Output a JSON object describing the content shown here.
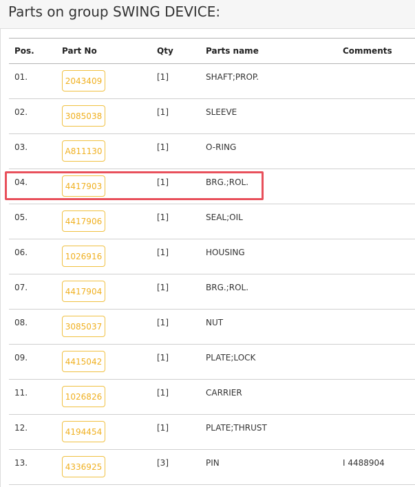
{
  "page": {
    "title": "Parts on group SWING DEVICE:"
  },
  "table": {
    "headers": {
      "pos": "Pos.",
      "part_no": "Part No",
      "qty": "Qty",
      "parts_name": "Parts name",
      "comments": "Comments"
    },
    "rows": [
      {
        "pos": "01.",
        "part_no": "2043409",
        "qty": "[1]",
        "name": "SHAFT;PROP.",
        "comments": ""
      },
      {
        "pos": "02.",
        "part_no": "3085038",
        "qty": "[1]",
        "name": "SLEEVE",
        "comments": ""
      },
      {
        "pos": "03.",
        "part_no": "A811130",
        "qty": "[1]",
        "name": "O-RING",
        "comments": ""
      },
      {
        "pos": "04.",
        "part_no": "4417903",
        "qty": "[1]",
        "name": "BRG.;ROL.",
        "comments": "",
        "highlighted": true
      },
      {
        "pos": "05.",
        "part_no": "4417906",
        "qty": "[1]",
        "name": "SEAL;OIL",
        "comments": ""
      },
      {
        "pos": "06.",
        "part_no": "1026916",
        "qty": "[1]",
        "name": "HOUSING",
        "comments": ""
      },
      {
        "pos": "07.",
        "part_no": "4417904",
        "qty": "[1]",
        "name": "BRG.;ROL.",
        "comments": ""
      },
      {
        "pos": "08.",
        "part_no": "3085037",
        "qty": "[1]",
        "name": "NUT",
        "comments": ""
      },
      {
        "pos": "09.",
        "part_no": "4415042",
        "qty": "[1]",
        "name": "PLATE;LOCK",
        "comments": ""
      },
      {
        "pos": "11.",
        "part_no": "1026826",
        "qty": "[1]",
        "name": "CARRIER",
        "comments": ""
      },
      {
        "pos": "12.",
        "part_no": "4194454",
        "qty": "[1]",
        "name": "PLATE;THRUST",
        "comments": ""
      },
      {
        "pos": "13.",
        "part_no": "4336925",
        "qty": "[3]",
        "name": "PIN",
        "comments": "I 4488904"
      }
    ]
  },
  "colors": {
    "part_button_text": "#f0b020",
    "part_button_border": "#f0c040",
    "highlight_border": "#e8505b"
  }
}
